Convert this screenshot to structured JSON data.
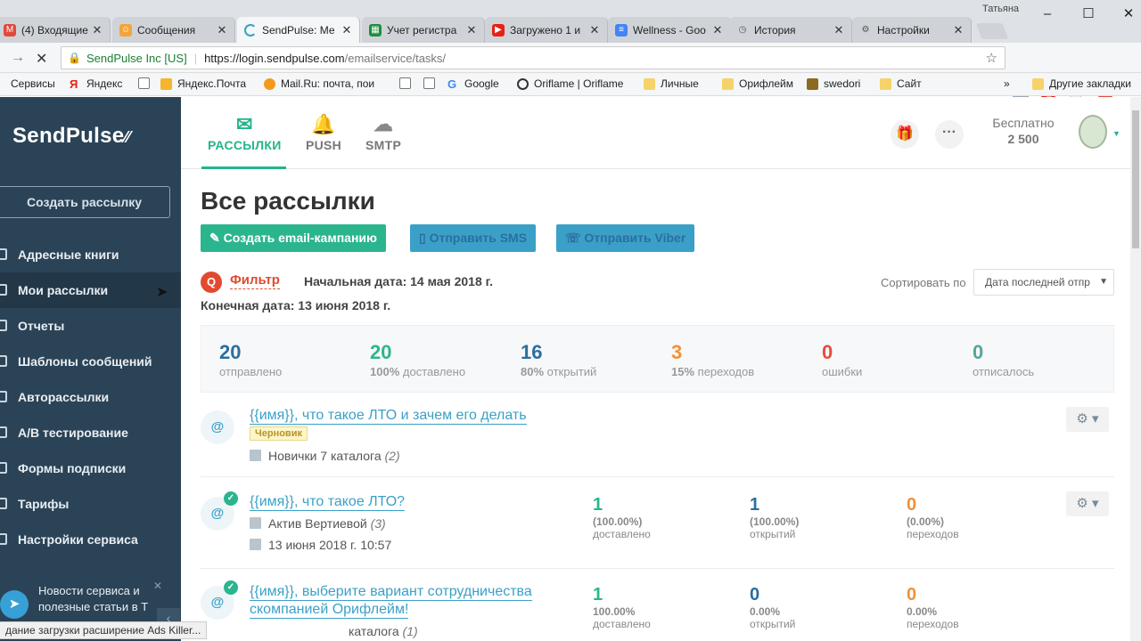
{
  "browser": {
    "user": "Татьяна",
    "tabs": [
      {
        "label": "(4) Входящие -",
        "icon": "mail-icon"
      },
      {
        "label": "Сообщения",
        "icon": "messages-icon"
      },
      {
        "label": "SendPulse: Ме",
        "icon": "loading-icon"
      },
      {
        "label": "Учет регистра",
        "icon": "sheets-icon"
      },
      {
        "label": "Загружено 1 и",
        "icon": "youtube-icon"
      },
      {
        "label": "Wellness - Goo",
        "icon": "docs-icon"
      },
      {
        "label": "История",
        "icon": "history-icon"
      },
      {
        "label": "Настройки",
        "icon": "settings-icon"
      }
    ],
    "address": {
      "site": "SendPulse Inc [US]",
      "url_main": "https://login.sendpulse.com",
      "url_path": "/emailservice/tasks/"
    },
    "bookmarks": [
      "Сервисы",
      "Яндекс",
      "Яндекс.Почта",
      "Mail.Ru: почта, пои",
      "Google",
      "Oriflame | Oriflame",
      "Личные",
      "Орифлейм",
      "swedori",
      "Сайт",
      "Другие закладки"
    ],
    "status": "дание загрузки расширение Ads Killer..."
  },
  "sidebar": {
    "logo": "SendPulse",
    "create_button": "Создать рассылку",
    "items": [
      {
        "label": "Адресные книги"
      },
      {
        "label": "Мои рассылки"
      },
      {
        "label": "Отчеты"
      },
      {
        "label": "Шаблоны сообщений"
      },
      {
        "label": "Авторассылки"
      },
      {
        "label": "A/B тестирование"
      },
      {
        "label": "Формы подписки"
      },
      {
        "label": "Тарифы"
      },
      {
        "label": "Настройки сервиса"
      }
    ],
    "news": "Новости сервиса и полезные статьи в Т"
  },
  "topnav": {
    "tabs": [
      {
        "label": "РАССЫЛКИ",
        "icon": "envelope-icon"
      },
      {
        "label": "PUSH",
        "icon": "bell-icon"
      },
      {
        "label": "SMTP",
        "icon": "cloud-icon"
      }
    ],
    "plan_label": "Бесплатно",
    "plan_value": "2 500"
  },
  "main": {
    "title": "Все рассылки",
    "actions": [
      "Создать email-кампанию",
      "Отправить SMS",
      "Отправить Viber"
    ],
    "filter": "Фильтр",
    "date_start": "Начальная дата: 14 мая 2018 г.",
    "date_end": "Конечная дата: 13 июня 2018 г.",
    "sort_label": "Сортировать по",
    "sort_value": "Дата последней отпр",
    "stats": [
      {
        "value": "20",
        "pct": "",
        "label": "отправлено",
        "color": "#2c6e9e"
      },
      {
        "value": "20",
        "pct": "100%",
        "label": "доставлено",
        "color": "#2bb58f"
      },
      {
        "value": "16",
        "pct": "80%",
        "label": "открытий",
        "color": "#2c6e9e"
      },
      {
        "value": "3",
        "pct": "15%",
        "label": "переходов",
        "color": "#f0913a"
      },
      {
        "value": "0",
        "pct": "",
        "label": "ошибки",
        "color": "#e74c3c"
      },
      {
        "value": "0",
        "pct": "",
        "label": "отписалось",
        "color": "#55a69b"
      }
    ],
    "campaigns": [
      {
        "title": "{{имя}}, что такое ЛТО и зачем его делать",
        "badge": "Черновик",
        "book": "Новички 7 каталога",
        "count": "(2)"
      },
      {
        "title": "{{имя}}, что такое ЛТО?",
        "book": "Актив Вертиевой",
        "count": "(3)",
        "date": "13 июня 2018 г. 10:57",
        "delivered": {
          "value": "1",
          "pct": "(100.00%)",
          "label": "доставлено"
        },
        "opened": {
          "value": "1",
          "pct": "(100.00%)",
          "label": "открытий"
        },
        "clicks": {
          "value": "0",
          "pct": "(0.00%)",
          "label": "переходов"
        }
      },
      {
        "title_line1": "{{имя}}, выберите вариант сотрудничества",
        "title_line2": "скомпанией Орифлейм!",
        "book": "каталога",
        "count": "(1)",
        "delivered": {
          "value": "1",
          "pct": "100.00%",
          "label": "доставлено"
        },
        "opened": {
          "value": "0",
          "pct": "0.00%",
          "label": "открытий"
        },
        "clicks": {
          "value": "0",
          "pct": "0.00%",
          "label": "переходов"
        }
      }
    ]
  }
}
